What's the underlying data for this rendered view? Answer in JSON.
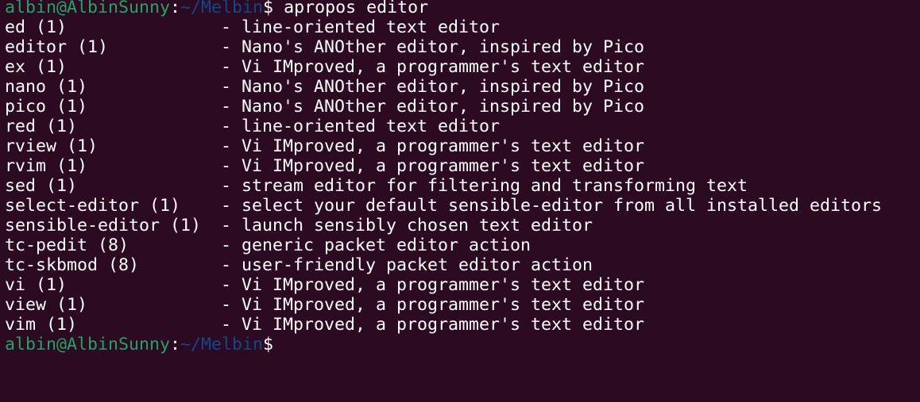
{
  "colors": {
    "background": "#2c0a22",
    "prompt_user": "#26a269",
    "prompt_path": "#12488b",
    "text": "#ffffff"
  },
  "prompt": {
    "user_host": "albin@AlbinSunny",
    "separator": ":",
    "path": "~/Melbin",
    "symbol": "$"
  },
  "command": " apropos editor",
  "results": [
    {
      "name": "ed (1)",
      "desc": "- line-oriented text editor"
    },
    {
      "name": "editor (1)",
      "desc": "- Nano's ANOther editor, inspired by Pico"
    },
    {
      "name": "ex (1)",
      "desc": "- Vi IMproved, a programmer's text editor"
    },
    {
      "name": "nano (1)",
      "desc": "- Nano's ANOther editor, inspired by Pico"
    },
    {
      "name": "pico (1)",
      "desc": "- Nano's ANOther editor, inspired by Pico"
    },
    {
      "name": "red (1)",
      "desc": "- line-oriented text editor"
    },
    {
      "name": "rview (1)",
      "desc": "- Vi IMproved, a programmer's text editor"
    },
    {
      "name": "rvim (1)",
      "desc": "- Vi IMproved, a programmer's text editor"
    },
    {
      "name": "sed (1)",
      "desc": "- stream editor for filtering and transforming text"
    },
    {
      "name": "select-editor (1)",
      "desc": "- select your default sensible-editor from all installed editors"
    },
    {
      "name": "sensible-editor (1)",
      "desc": "- launch sensibly chosen text editor"
    },
    {
      "name": "tc-pedit (8)",
      "desc": "- generic packet editor action"
    },
    {
      "name": "tc-skbmod (8)",
      "desc": "- user-friendly packet editor action"
    },
    {
      "name": "vi (1)",
      "desc": "- Vi IMproved, a programmer's text editor"
    },
    {
      "name": "view (1)",
      "desc": "- Vi IMproved, a programmer's text editor"
    },
    {
      "name": "vim (1)",
      "desc": "- Vi IMproved, a programmer's text editor"
    }
  ]
}
